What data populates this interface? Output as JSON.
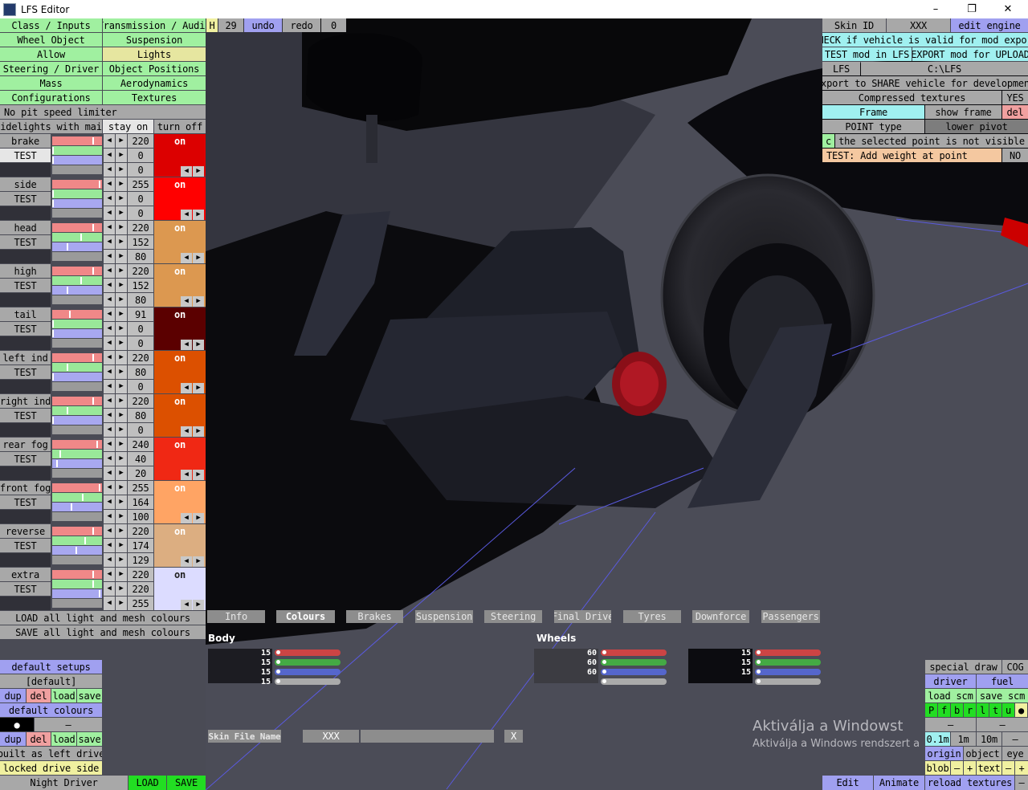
{
  "window": {
    "title": "LFS Editor",
    "min": "–",
    "max": "❐",
    "close": "✕"
  },
  "left_menu": {
    "class_inputs": "Class / Inputs",
    "transmission_audio": "Transmission / Audio",
    "wheel_object": "Wheel Object",
    "suspension": "Suspension",
    "allow": "Allow",
    "lights": "Lights",
    "steering_driver": "Steering / Driver",
    "object_positions": "Object Positions",
    "mass": "Mass",
    "aerodynamics": "Aerodynamics",
    "configurations": "Configurations",
    "textures": "Textures",
    "no_pit": "No pit speed limiter",
    "sidelights": "Sidelights with main",
    "stay_on": "stay on",
    "turn_off": "turn off"
  },
  "top_bar": {
    "h": "H",
    "num": "29",
    "undo": "undo",
    "redo": "redo",
    "zero": "0"
  },
  "lights": [
    {
      "name": "brake",
      "test": "TEST",
      "r": "220",
      "g": "0",
      "b": "0",
      "state": "on",
      "color": "#dc0000",
      "sel": true
    },
    {
      "name": "side",
      "test": "TEST",
      "r": "255",
      "g": "0",
      "b": "0",
      "state": "on",
      "color": "#ff0000"
    },
    {
      "name": "head",
      "test": "TEST",
      "r": "220",
      "g": "152",
      "b": "80",
      "state": "on",
      "color": "#dc9850"
    },
    {
      "name": "high",
      "test": "TEST",
      "r": "220",
      "g": "152",
      "b": "80",
      "state": "on",
      "color": "#dc9850"
    },
    {
      "name": "tail",
      "test": "TEST",
      "r": "91",
      "g": "0",
      "b": "0",
      "state": "on",
      "color": "#5b0000"
    },
    {
      "name": "left ind",
      "test": "TEST",
      "r": "220",
      "g": "80",
      "b": "0",
      "state": "on",
      "color": "#dc5000"
    },
    {
      "name": "right ind",
      "test": "TEST",
      "r": "220",
      "g": "80",
      "b": "0",
      "state": "on",
      "color": "#dc5000"
    },
    {
      "name": "rear fog",
      "test": "TEST",
      "r": "240",
      "g": "40",
      "b": "20",
      "state": "on",
      "color": "#f02814"
    },
    {
      "name": "front fog",
      "test": "TEST",
      "r": "255",
      "g": "164",
      "b": "100",
      "state": "on",
      "color": "#ffa464"
    },
    {
      "name": "reverse",
      "test": "TEST",
      "r": "220",
      "g": "174",
      "b": "129",
      "state": "on",
      "color": "#dcae81"
    },
    {
      "name": "extra",
      "test": "TEST",
      "r": "220",
      "g": "220",
      "b": "255",
      "state": "on",
      "color": "#dcdcff"
    }
  ],
  "load_all": "LOAD all light and mesh colours",
  "save_all": "SAVE all light and mesh colours",
  "setups": {
    "default_setups": "default setups",
    "default_name": "[default]",
    "dup": "dup",
    "del": "del",
    "load": "load",
    "save": "save",
    "default_colours": "default colours",
    "dot": "●",
    "dash": "–",
    "built_left": "built as left drive",
    "locked": "locked drive side",
    "driver": "Night Driver",
    "load_btn": "LOAD",
    "save_btn": "SAVE"
  },
  "top_right": {
    "skin_id": "Skin ID",
    "skin_val": "XXX",
    "edit_engine": "edit engine",
    "check": "CHECK if vehicle is valid for mod export",
    "test_mod": "TEST mod in LFS",
    "export_mod": "EXPORT mod for UPLOAD",
    "lfs": "LFS",
    "path": "C:\\LFS",
    "export_share": "export to SHARE vehicle for development",
    "compressed": "Compressed textures",
    "yes": "YES",
    "frame": "Frame",
    "show_frame": "show frame",
    "del": "del",
    "point_type": "POINT type",
    "lower_pivot": "lower pivot",
    "c": "c",
    "not_visible": "the selected point is not visible",
    "test_weight": "TEST: Add weight at point",
    "no": "NO"
  },
  "tabs": [
    "Info",
    "Colours",
    "Brakes",
    "Suspension",
    "Steering",
    "Final Drive",
    "Tyres",
    "Downforce",
    "Passengers"
  ],
  "colours_panel": {
    "body_label": "Body",
    "wheels_label": "Wheels",
    "body_vals": [
      "15",
      "15",
      "15",
      "15"
    ],
    "wheel1_vals": [
      "60",
      "60",
      "60"
    ],
    "wheel2_vals": [
      "15",
      "15",
      "15"
    ]
  },
  "skin_file": {
    "label": "Skin File Name",
    "value": "XXX",
    "x": "X"
  },
  "watermark": {
    "line1": "Aktiválja a Windowst",
    "line2": "Aktiválja a Windows rendszert a"
  },
  "bottom_right": {
    "special_draw": "special draw",
    "cog": "COG",
    "driver": "driver",
    "fuel": "fuel",
    "load_scm": "load scm",
    "save_scm": "save scm",
    "letters": [
      "P",
      "f",
      "b",
      "r",
      "l",
      "t",
      "u",
      "●"
    ],
    "dash": "–",
    "m01": "0.1m",
    "m1": "1m",
    "m10": "10m",
    "origin": "origin",
    "object": "object",
    "eye": "eye",
    "blob": "blob",
    "minus": "–",
    "plus": "+",
    "text": "text",
    "edit": "Edit",
    "animate": "Animate",
    "reload": "reload textures"
  }
}
